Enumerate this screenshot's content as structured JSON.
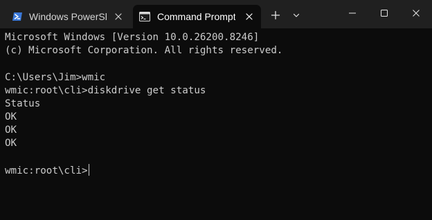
{
  "tabs": [
    {
      "label": "Windows PowerSh",
      "icon": "powershell-icon",
      "active": false
    },
    {
      "label": "Command Prompt",
      "icon": "cmd-icon",
      "active": true
    }
  ],
  "tabbar": {
    "new_tab_icon": "plus-icon",
    "dropdown_icon": "chevron-down-icon"
  },
  "window_controls": {
    "minimize_icon": "minimize-icon",
    "maximize_icon": "maximize-icon",
    "close_icon": "close-icon"
  },
  "terminal": {
    "lines": [
      "Microsoft Windows [Version 10.0.26200.8246]",
      "(c) Microsoft Corporation. All rights reserved.",
      "",
      "C:\\Users\\Jim>wmic",
      "wmic:root\\cli>diskdrive get status",
      "Status",
      "OK",
      "OK",
      "OK",
      "",
      "wmic:root\\cli>"
    ]
  },
  "colors": {
    "titlebar_bg": "#202020",
    "terminal_bg": "#0c0c0c",
    "terminal_text": "#cccccc",
    "powershell_icon": "#3a78d8"
  }
}
